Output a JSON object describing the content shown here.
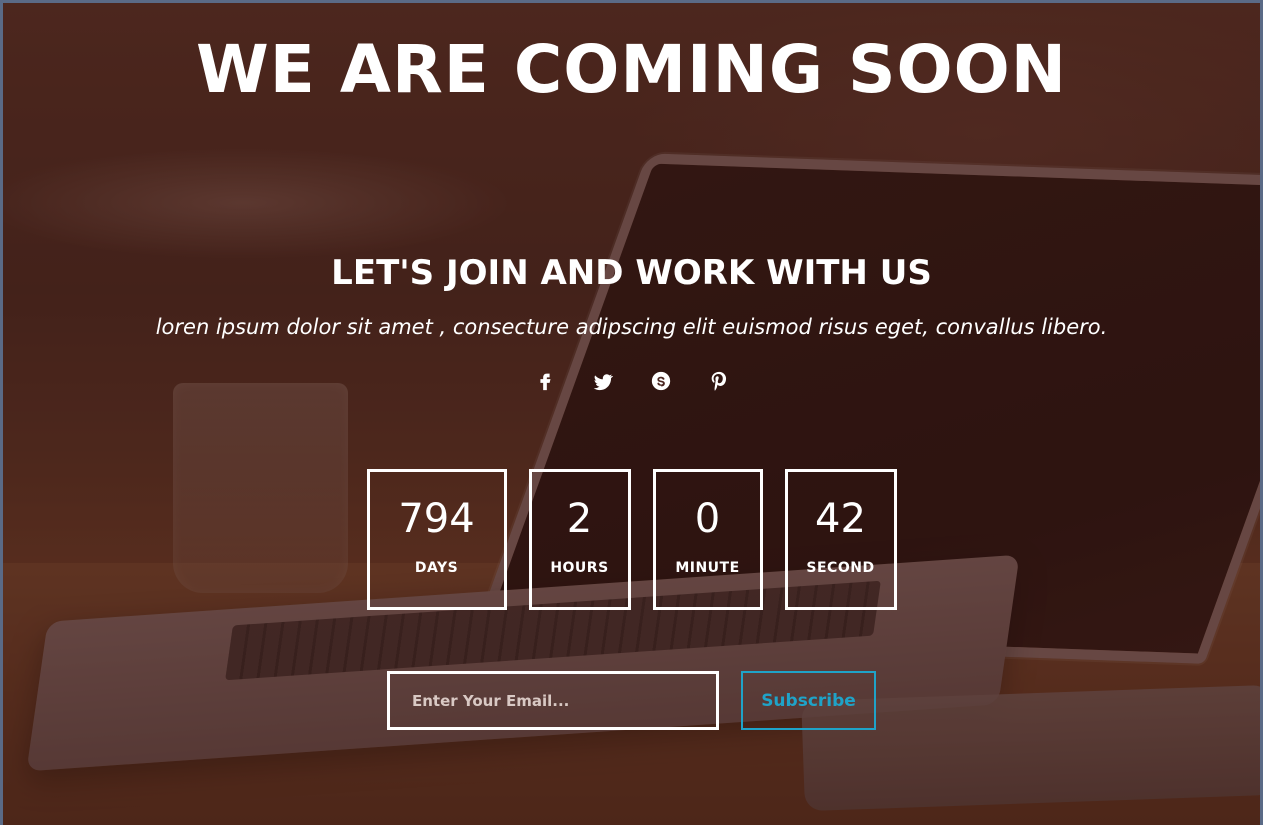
{
  "hero": {
    "headline": "WE ARE COMING SOON",
    "subheadline": "LET'S JOIN AND WORK WITH US",
    "tagline": "loren ipsum dolor sit amet , consecture adipscing elit euismod risus eget, convallus libero."
  },
  "social": {
    "icons": [
      "facebook-icon",
      "twitter-icon",
      "skype-icon",
      "pinterest-icon"
    ]
  },
  "countdown": {
    "days": {
      "value": "794",
      "label": "DAYS"
    },
    "hours": {
      "value": "2",
      "label": "HOURS"
    },
    "minute": {
      "value": "0",
      "label": "MINUTE"
    },
    "second": {
      "value": "42",
      "label": "SECOND"
    }
  },
  "subscribe": {
    "placeholder": "Enter Your Email...",
    "button_label": "Subscribe"
  },
  "colors": {
    "accent": "#1fa3c8",
    "text": "#ffffff"
  }
}
